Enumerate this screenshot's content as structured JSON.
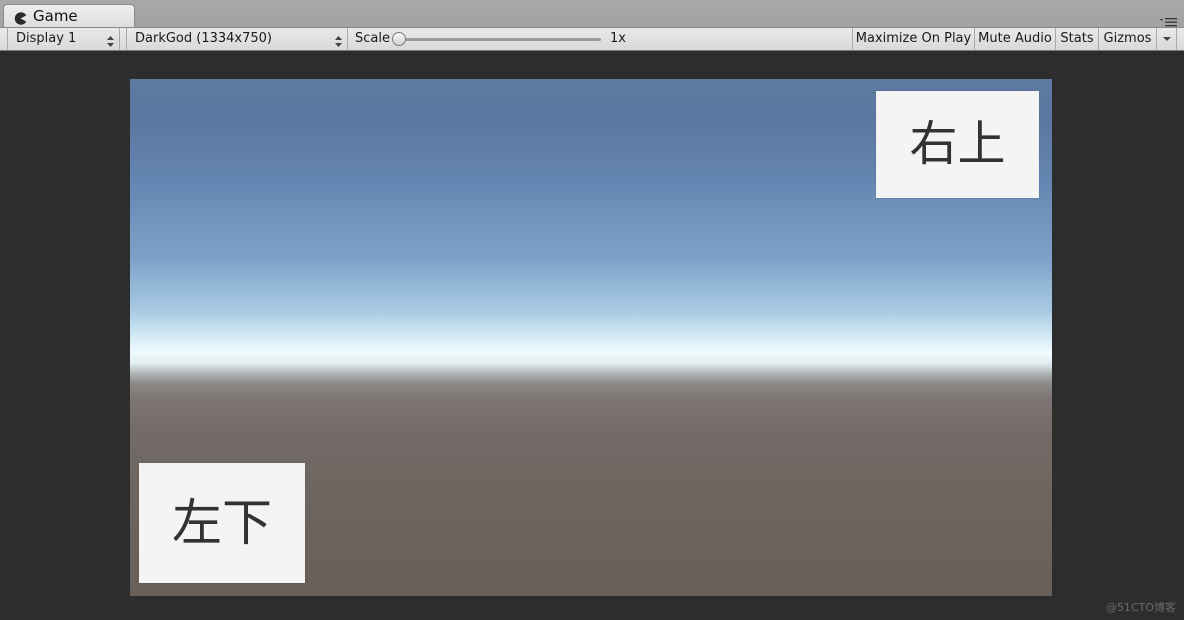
{
  "window": {
    "tab_title": "Game",
    "tab_icon": "pacman-icon",
    "tab_menu_icon": "menu-lines-icon"
  },
  "toolbar": {
    "display_select": "Display 1",
    "resolution_select": "DarkGod (1334x750)",
    "scale_label": "Scale",
    "scale_value": "1x",
    "scale_level": 0,
    "buttons": {
      "maximize_on_play": "Maximize On Play",
      "mute_audio": "Mute Audio",
      "stats": "Stats",
      "gizmos": "Gizmos"
    }
  },
  "viewport": {
    "top_right_label": "右上",
    "bottom_left_label": "左下"
  },
  "watermark": "@51CTO博客",
  "colors": {
    "editor_background": "#2d2d2d",
    "toolbar_background": "#e0e0e0",
    "ui_box_background": "#f4f4f4",
    "ui_box_text": "#323232"
  }
}
